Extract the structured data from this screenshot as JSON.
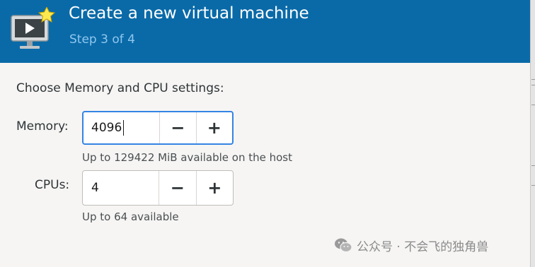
{
  "header": {
    "title": "Create a new virtual machine",
    "step": "Step 3 of 4",
    "icon": "monitor-star-icon"
  },
  "prompt": "Choose Memory and CPU settings:",
  "memory": {
    "label": "Memory:",
    "value": "4096",
    "decrement": "−",
    "increment": "+",
    "hint": "Up to 129422 MiB available on the host"
  },
  "cpus": {
    "label": "CPUs:",
    "value": "4",
    "decrement": "−",
    "increment": "+",
    "hint": "Up to 64 available"
  },
  "watermark": {
    "text": "公众号 · 不会飞的独角兽",
    "icon": "wechat-icon"
  },
  "colors": {
    "header_bg": "#0a6aa8",
    "step_text": "#8fc7ee",
    "focus_border": "#3584e4",
    "window_bg": "#f6f5f4"
  }
}
